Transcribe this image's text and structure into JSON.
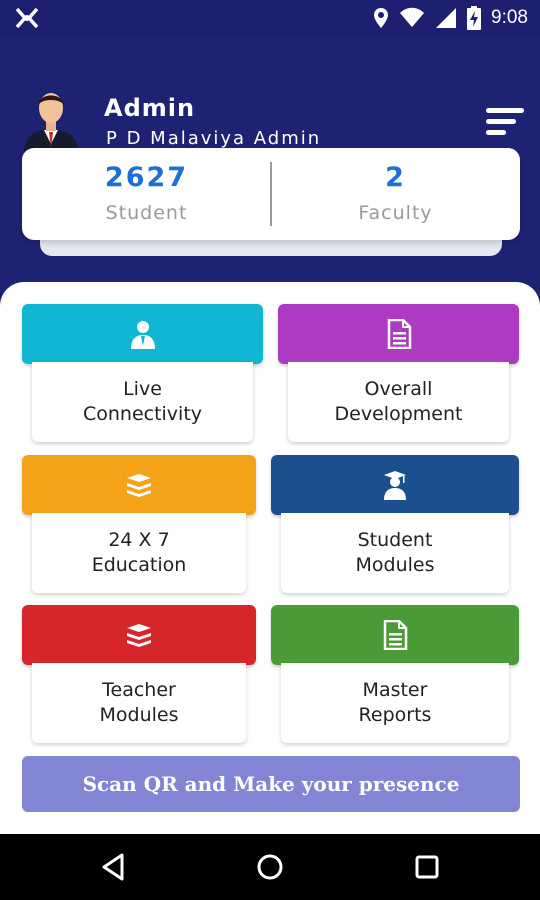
{
  "status_bar": {
    "time": "9:08",
    "icons": [
      "app-logo-icon",
      "location-icon",
      "wifi-icon",
      "signal-icon",
      "battery-charging-icon"
    ]
  },
  "header": {
    "name": "Admin",
    "subtitle": "P D Malaviya Admin"
  },
  "stats": [
    {
      "value": "2627",
      "label": "Student"
    },
    {
      "value": "2",
      "label": "Faculty"
    }
  ],
  "tiles": [
    {
      "label": "Live\nConnectivity",
      "icon": "user-tie-icon",
      "color": "#10b7d3"
    },
    {
      "label": "Overall\nDevelopment",
      "icon": "document-icon",
      "color": "#ac3bc1"
    },
    {
      "label": "24 X 7\nEducation",
      "icon": "books-stack-icon",
      "color": "#f5a31a"
    },
    {
      "label": "Student\nModules",
      "icon": "graduate-icon",
      "color": "#1b4f8f"
    },
    {
      "label": "Teacher\nModules",
      "icon": "books-stack-icon",
      "color": "#d6262b"
    },
    {
      "label": "Master\nReports",
      "icon": "document-icon",
      "color": "#4a9b36"
    }
  ],
  "scan_button": {
    "label": "Scan QR and Make your presence"
  },
  "colors": {
    "header_bg": "#1e2272",
    "stat_number": "#1d6fd8",
    "scan_bg": "#8185d3"
  }
}
